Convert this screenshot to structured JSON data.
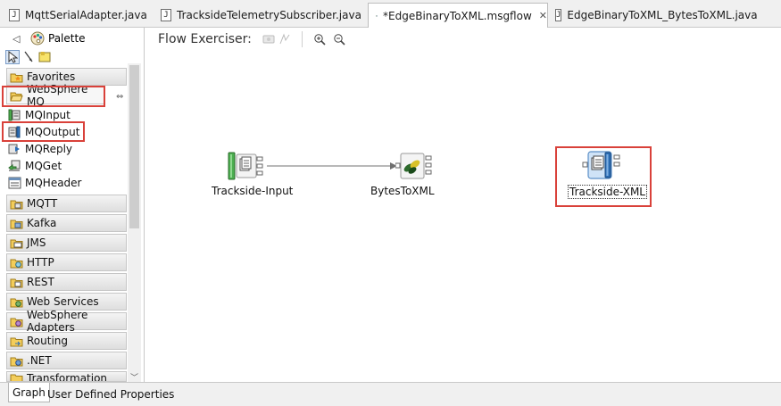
{
  "tabs": [
    {
      "label": "MqttSerialAdapter.java",
      "type": "java"
    },
    {
      "label": "TracksideTelemetrySubscriber.java",
      "type": "java"
    },
    {
      "label": "*EdgeBinaryToXML.msgflow",
      "type": "msgflow",
      "active": true,
      "close": "✕"
    },
    {
      "label": "EdgeBinaryToXML_BytesToXML.java",
      "type": "java"
    }
  ],
  "palette": {
    "title": "Palette",
    "drawers": [
      {
        "label": "Favorites"
      },
      {
        "label": "WebSphere MQ",
        "expanded": true,
        "highlighted": true
      },
      {
        "label": "MQTT"
      },
      {
        "label": "Kafka"
      },
      {
        "label": "JMS"
      },
      {
        "label": "HTTP"
      },
      {
        "label": "REST"
      },
      {
        "label": "Web Services"
      },
      {
        "label": "WebSphere Adapters"
      },
      {
        "label": "Routing"
      },
      {
        "label": ".NET"
      },
      {
        "label": "Transformation"
      }
    ],
    "items": [
      {
        "label": "MQInput"
      },
      {
        "label": "MQOutput",
        "highlighted": true
      },
      {
        "label": "MQReply"
      },
      {
        "label": "MQGet"
      },
      {
        "label": "MQHeader"
      }
    ]
  },
  "toolbar": {
    "flow_exerciser_label": "Flow Exerciser:"
  },
  "nodes": [
    {
      "label": "Trackside-Input"
    },
    {
      "label": "BytesToXML"
    },
    {
      "label": "Trackside-XML",
      "selected": true,
      "highlighted": true
    }
  ],
  "bottom_tabs": [
    {
      "label": "Graph",
      "active": true
    },
    {
      "label": "User Defined Properties"
    }
  ],
  "colors": {
    "highlight": "#d9413a",
    "node_blue": "#2c6fb7",
    "node_green": "#4caf50"
  }
}
